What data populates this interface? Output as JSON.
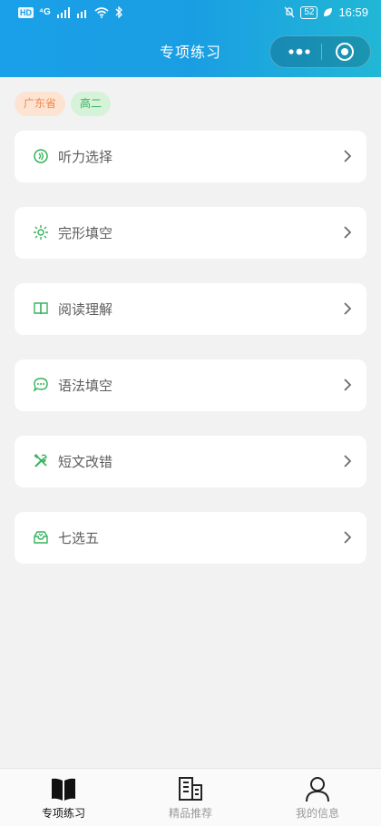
{
  "status": {
    "icons_left": [
      "hd-icon",
      "4g-signal-icon",
      "x-signal-icon",
      "wifi-icon",
      "bluetooth-icon"
    ],
    "left_tags": [
      "HD",
      "⁴G"
    ],
    "battery": "52",
    "time": "16:59"
  },
  "header": {
    "title": "专项练习"
  },
  "chips": [
    "广东省",
    "高二"
  ],
  "cards": [
    {
      "label": "听力选择",
      "icon": "listening-icon"
    },
    {
      "label": "完形填空",
      "icon": "spark-icon"
    },
    {
      "label": "阅读理解",
      "icon": "book-icon"
    },
    {
      "label": "语法填空",
      "icon": "chat-bubble-icon"
    },
    {
      "label": "短文改错",
      "icon": "tools-icon"
    },
    {
      "label": "七选五",
      "icon": "inbox-icon"
    }
  ],
  "tabs": [
    {
      "label": "专项练习",
      "icon": "open-book-icon",
      "active": true
    },
    {
      "label": "精品推荐",
      "icon": "building-icon",
      "active": false
    },
    {
      "label": "我的信息",
      "icon": "user-icon",
      "active": false
    }
  ],
  "colors": {
    "accent": "#1aa0e8",
    "icon_green": "#35b35c",
    "chip_orange": "#f08a4b"
  }
}
